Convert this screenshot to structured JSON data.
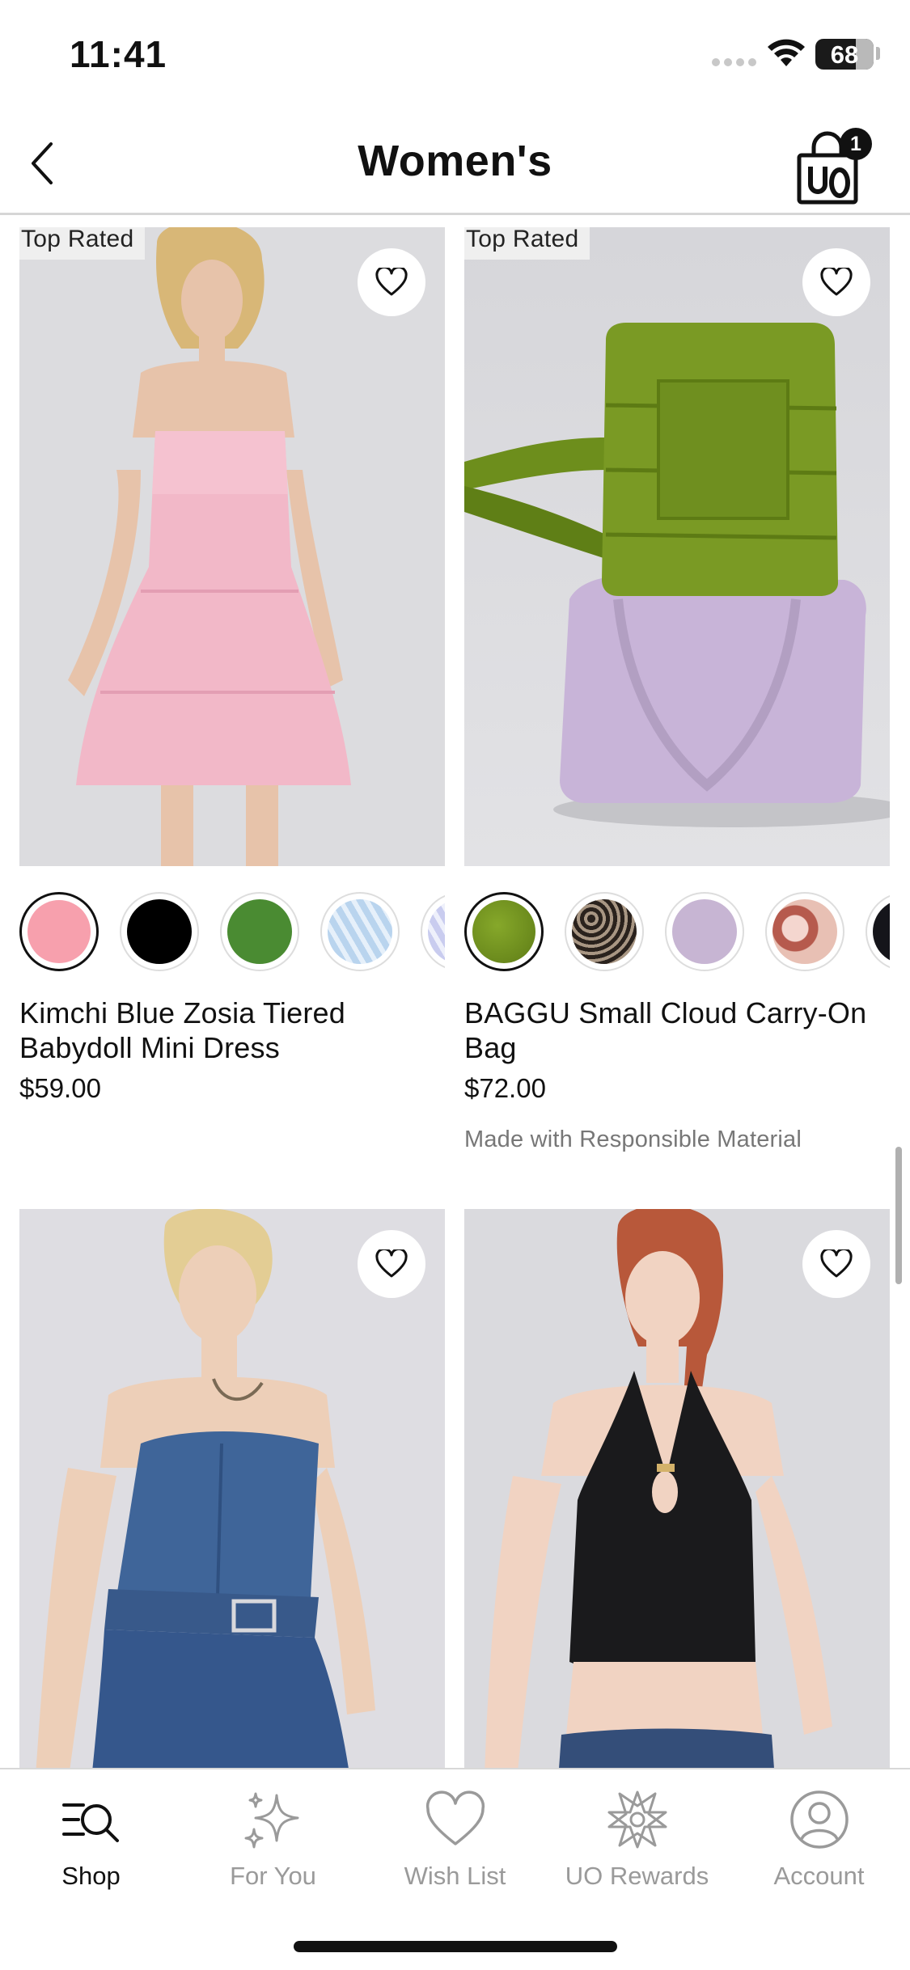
{
  "status_bar": {
    "time": "11:41",
    "battery": "68"
  },
  "header": {
    "title": "Women's",
    "bag_count": "1"
  },
  "products": [
    {
      "badge": "Top Rated",
      "name": "Kimchi Blue Zosia Tiered Babydoll Mini Dress",
      "price": "$59.00",
      "note": "",
      "swatches": [
        {
          "name": "pink",
          "color": "#f7a0ad",
          "selected": true
        },
        {
          "name": "black",
          "color": "#000000",
          "selected": false
        },
        {
          "name": "green",
          "color": "#4a8b32",
          "selected": false
        },
        {
          "name": "blue stripe",
          "color": "#b9d4ee",
          "selected": false
        },
        {
          "name": "lavender stripe",
          "color": "#d7d9f3",
          "selected": false
        }
      ]
    },
    {
      "badge": "Top Rated",
      "name": "BAGGU Small Cloud Carry-On Bag",
      "price": "$72.00",
      "note": "Made with Responsible Material",
      "swatches": [
        {
          "name": "olive",
          "color": "#6f8e1c",
          "selected": true
        },
        {
          "name": "snakeskin",
          "color": "#6b5a4a",
          "selected": false
        },
        {
          "name": "lilac",
          "color": "#c7b5d3",
          "selected": false
        },
        {
          "name": "floral",
          "color": "#c7776a",
          "selected": false
        },
        {
          "name": "black",
          "color": "#15151a",
          "selected": false
        }
      ]
    },
    {
      "badge": "",
      "name": "",
      "price": "",
      "note": ""
    },
    {
      "badge": "",
      "name": "",
      "price": "",
      "note": ""
    }
  ],
  "tabs": [
    {
      "label": "Shop",
      "icon": "shop-search-icon",
      "active": true
    },
    {
      "label": "For You",
      "icon": "sparkle-icon",
      "active": false
    },
    {
      "label": "Wish List",
      "icon": "heart-icon",
      "active": false
    },
    {
      "label": "UO Rewards",
      "icon": "rewards-star-icon",
      "active": false
    },
    {
      "label": "Account",
      "icon": "account-icon",
      "active": false
    }
  ]
}
